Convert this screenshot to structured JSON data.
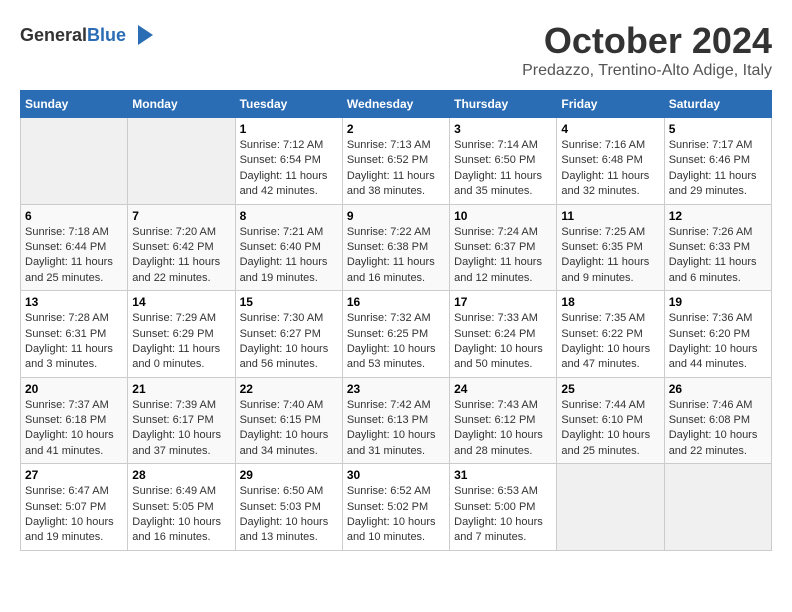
{
  "header": {
    "logo_general": "General",
    "logo_blue": "Blue",
    "month": "October 2024",
    "location": "Predazzo, Trentino-Alto Adige, Italy"
  },
  "days_of_week": [
    "Sunday",
    "Monday",
    "Tuesday",
    "Wednesday",
    "Thursday",
    "Friday",
    "Saturday"
  ],
  "weeks": [
    [
      {
        "day": "",
        "info": ""
      },
      {
        "day": "",
        "info": ""
      },
      {
        "day": "1",
        "info": "Sunrise: 7:12 AM\nSunset: 6:54 PM\nDaylight: 11 hours and 42 minutes."
      },
      {
        "day": "2",
        "info": "Sunrise: 7:13 AM\nSunset: 6:52 PM\nDaylight: 11 hours and 38 minutes."
      },
      {
        "day": "3",
        "info": "Sunrise: 7:14 AM\nSunset: 6:50 PM\nDaylight: 11 hours and 35 minutes."
      },
      {
        "day": "4",
        "info": "Sunrise: 7:16 AM\nSunset: 6:48 PM\nDaylight: 11 hours and 32 minutes."
      },
      {
        "day": "5",
        "info": "Sunrise: 7:17 AM\nSunset: 6:46 PM\nDaylight: 11 hours and 29 minutes."
      }
    ],
    [
      {
        "day": "6",
        "info": "Sunrise: 7:18 AM\nSunset: 6:44 PM\nDaylight: 11 hours and 25 minutes."
      },
      {
        "day": "7",
        "info": "Sunrise: 7:20 AM\nSunset: 6:42 PM\nDaylight: 11 hours and 22 minutes."
      },
      {
        "day": "8",
        "info": "Sunrise: 7:21 AM\nSunset: 6:40 PM\nDaylight: 11 hours and 19 minutes."
      },
      {
        "day": "9",
        "info": "Sunrise: 7:22 AM\nSunset: 6:38 PM\nDaylight: 11 hours and 16 minutes."
      },
      {
        "day": "10",
        "info": "Sunrise: 7:24 AM\nSunset: 6:37 PM\nDaylight: 11 hours and 12 minutes."
      },
      {
        "day": "11",
        "info": "Sunrise: 7:25 AM\nSunset: 6:35 PM\nDaylight: 11 hours and 9 minutes."
      },
      {
        "day": "12",
        "info": "Sunrise: 7:26 AM\nSunset: 6:33 PM\nDaylight: 11 hours and 6 minutes."
      }
    ],
    [
      {
        "day": "13",
        "info": "Sunrise: 7:28 AM\nSunset: 6:31 PM\nDaylight: 11 hours and 3 minutes."
      },
      {
        "day": "14",
        "info": "Sunrise: 7:29 AM\nSunset: 6:29 PM\nDaylight: 11 hours and 0 minutes."
      },
      {
        "day": "15",
        "info": "Sunrise: 7:30 AM\nSunset: 6:27 PM\nDaylight: 10 hours and 56 minutes."
      },
      {
        "day": "16",
        "info": "Sunrise: 7:32 AM\nSunset: 6:25 PM\nDaylight: 10 hours and 53 minutes."
      },
      {
        "day": "17",
        "info": "Sunrise: 7:33 AM\nSunset: 6:24 PM\nDaylight: 10 hours and 50 minutes."
      },
      {
        "day": "18",
        "info": "Sunrise: 7:35 AM\nSunset: 6:22 PM\nDaylight: 10 hours and 47 minutes."
      },
      {
        "day": "19",
        "info": "Sunrise: 7:36 AM\nSunset: 6:20 PM\nDaylight: 10 hours and 44 minutes."
      }
    ],
    [
      {
        "day": "20",
        "info": "Sunrise: 7:37 AM\nSunset: 6:18 PM\nDaylight: 10 hours and 41 minutes."
      },
      {
        "day": "21",
        "info": "Sunrise: 7:39 AM\nSunset: 6:17 PM\nDaylight: 10 hours and 37 minutes."
      },
      {
        "day": "22",
        "info": "Sunrise: 7:40 AM\nSunset: 6:15 PM\nDaylight: 10 hours and 34 minutes."
      },
      {
        "day": "23",
        "info": "Sunrise: 7:42 AM\nSunset: 6:13 PM\nDaylight: 10 hours and 31 minutes."
      },
      {
        "day": "24",
        "info": "Sunrise: 7:43 AM\nSunset: 6:12 PM\nDaylight: 10 hours and 28 minutes."
      },
      {
        "day": "25",
        "info": "Sunrise: 7:44 AM\nSunset: 6:10 PM\nDaylight: 10 hours and 25 minutes."
      },
      {
        "day": "26",
        "info": "Sunrise: 7:46 AM\nSunset: 6:08 PM\nDaylight: 10 hours and 22 minutes."
      }
    ],
    [
      {
        "day": "27",
        "info": "Sunrise: 6:47 AM\nSunset: 5:07 PM\nDaylight: 10 hours and 19 minutes."
      },
      {
        "day": "28",
        "info": "Sunrise: 6:49 AM\nSunset: 5:05 PM\nDaylight: 10 hours and 16 minutes."
      },
      {
        "day": "29",
        "info": "Sunrise: 6:50 AM\nSunset: 5:03 PM\nDaylight: 10 hours and 13 minutes."
      },
      {
        "day": "30",
        "info": "Sunrise: 6:52 AM\nSunset: 5:02 PM\nDaylight: 10 hours and 10 minutes."
      },
      {
        "day": "31",
        "info": "Sunrise: 6:53 AM\nSunset: 5:00 PM\nDaylight: 10 hours and 7 minutes."
      },
      {
        "day": "",
        "info": ""
      },
      {
        "day": "",
        "info": ""
      }
    ]
  ]
}
